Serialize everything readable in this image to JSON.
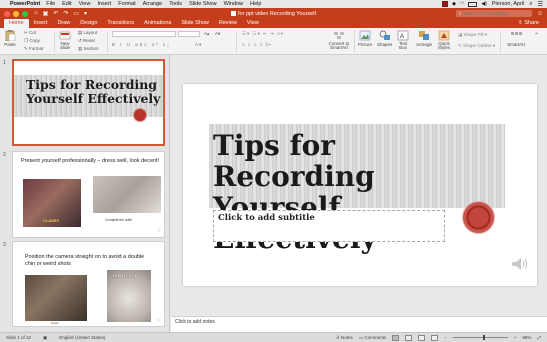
{
  "menubar": {
    "app": "PowerPoint",
    "items": [
      "File",
      "Edit",
      "View",
      "Insert",
      "Format",
      "Arrange",
      "Tools",
      "Slide Show",
      "Window",
      "Help"
    ],
    "user": "Pierson, April"
  },
  "window": {
    "title": "for ppt video Recording Yourself",
    "search_placeholder": "Search in Presentation"
  },
  "ribbon": {
    "tabs": [
      "Home",
      "Insert",
      "Draw",
      "Design",
      "Transitions",
      "Animations",
      "Slide Show",
      "Review",
      "View"
    ],
    "active_tab": "Home",
    "share_label": "Share",
    "paste": "Paste",
    "cut": "Cut",
    "copy": "Copy",
    "format": "Format",
    "new_slide": "New Slide",
    "layout": "Layout",
    "reset": "Reset",
    "section": "Section",
    "convert": "Convert to SmartArt",
    "picture": "Picture",
    "shapes": "Shapes",
    "textbox": "Text Box",
    "arrange": "Arrange",
    "quick_styles": "Quick Styles",
    "shape_fill": "Shape Fill",
    "shape_outline": "Shape Outline",
    "smartart": "SmartArt"
  },
  "thumbnails": [
    {
      "number": "1",
      "title_line1": "Tips for Recording",
      "title_line2": "Yourself Effectively"
    },
    {
      "number": "2",
      "text": "Present yourself professionally – dress well, look decent!",
      "caption_a": "CLASSY",
      "caption_b": "Complete the outfit"
    },
    {
      "number": "3",
      "text": "Position the camera straight on to avoid a double chin or weird shots",
      "caption_a": "Good",
      "caption_b": "HOW I LOOK"
    }
  ],
  "slide": {
    "title_line1": "Tips for Recording",
    "title_line2": "Yourself Effectively",
    "subtitle_placeholder": "Click to add subtitle"
  },
  "notes_placeholder": "Click to add notes",
  "status": {
    "slide_counter": "Slide 1 of 12",
    "language": "English (United States)",
    "notes": "Notes",
    "comments": "Comments",
    "zoom": "98%"
  },
  "colors": {
    "accent": "#c43e1c",
    "seal": "#b8332a"
  }
}
